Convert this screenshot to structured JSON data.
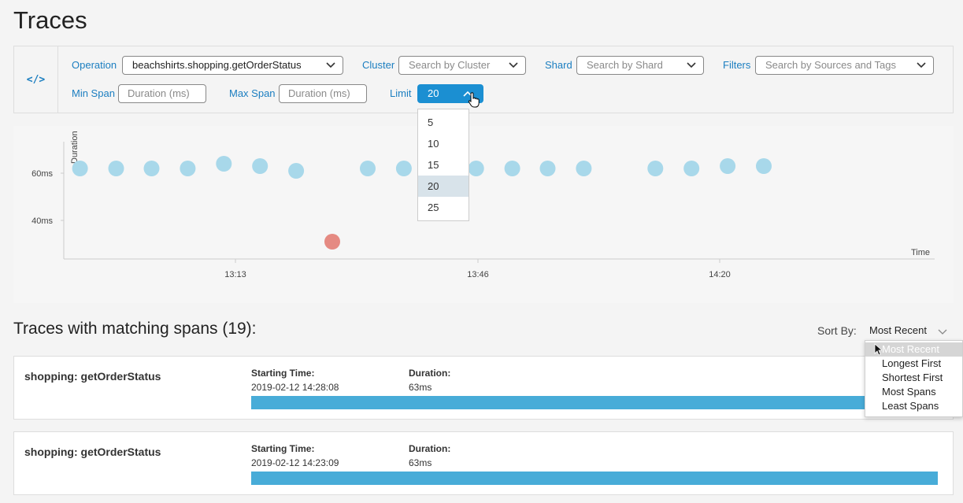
{
  "page": {
    "title": "Traces"
  },
  "query": {
    "code_toggle": "</>",
    "operation_label": "Operation",
    "operation_value": "beachshirts.shopping.getOrderStatus",
    "cluster_label": "Cluster",
    "cluster_placeholder": "Search by Cluster",
    "shard_label": "Shard",
    "shard_placeholder": "Search by Shard",
    "filters_label": "Filters",
    "filters_placeholder": "Search by Sources and Tags",
    "min_span_label": "Min Span",
    "min_span_placeholder": "Duration (ms)",
    "max_span_label": "Max Span",
    "max_span_placeholder": "Duration (ms)",
    "limit_label": "Limit",
    "limit_value": "20",
    "limit_options": [
      "5",
      "10",
      "15",
      "20",
      "25"
    ],
    "limit_selected": "20"
  },
  "chart_data": {
    "type": "scatter",
    "xlabel": "Time",
    "ylabel": "Duration",
    "x_ticks": [
      "13:13",
      "13:46",
      "14:20"
    ],
    "y_ticks": [
      "60ms",
      "40ms"
    ],
    "ylim_ms": [
      25,
      73
    ],
    "x_unit": "minutes after 12:48",
    "series": [
      {
        "color": "#a8d8ea",
        "points": [
          {
            "x": 3.5,
            "y": 62
          },
          {
            "x": 8.5,
            "y": 62
          },
          {
            "x": 13.4,
            "y": 62
          },
          {
            "x": 18.4,
            "y": 62
          },
          {
            "x": 23.4,
            "y": 64
          },
          {
            "x": 28.4,
            "y": 63
          },
          {
            "x": 33.4,
            "y": 61
          },
          {
            "x": 43.3,
            "y": 62
          },
          {
            "x": 48.3,
            "y": 62
          },
          {
            "x": 58.3,
            "y": 62
          },
          {
            "x": 63.3,
            "y": 62
          },
          {
            "x": 68.2,
            "y": 62
          },
          {
            "x": 73.2,
            "y": 62
          },
          {
            "x": 83.1,
            "y": 62
          },
          {
            "x": 88.1,
            "y": 62
          },
          {
            "x": 93.1,
            "y": 63
          },
          {
            "x": 98.1,
            "y": 63
          }
        ]
      },
      {
        "color": "#e58a82",
        "points": [
          {
            "x": 38.4,
            "y": 31
          }
        ]
      }
    ]
  },
  "results": {
    "heading": "Traces with matching spans (19):",
    "sort_label": "Sort By:",
    "sort_value": "Most Recent",
    "sort_options": [
      "Most Recent",
      "Longest First",
      "Shortest First",
      "Most Spans",
      "Least Spans"
    ],
    "start_label": "Starting Time:",
    "duration_label": "Duration:",
    "traces": [
      {
        "name": "shopping: getOrderStatus",
        "start": "2019-02-12 14:28:08",
        "duration": "63ms"
      },
      {
        "name": "shopping: getOrderStatus",
        "start": "2019-02-12 14:23:09",
        "duration": "63ms"
      }
    ]
  },
  "colors": {
    "accent": "#1b8fd2",
    "bar": "#48acd8",
    "point": "#a8d8ea",
    "outlier": "#e58a82"
  }
}
